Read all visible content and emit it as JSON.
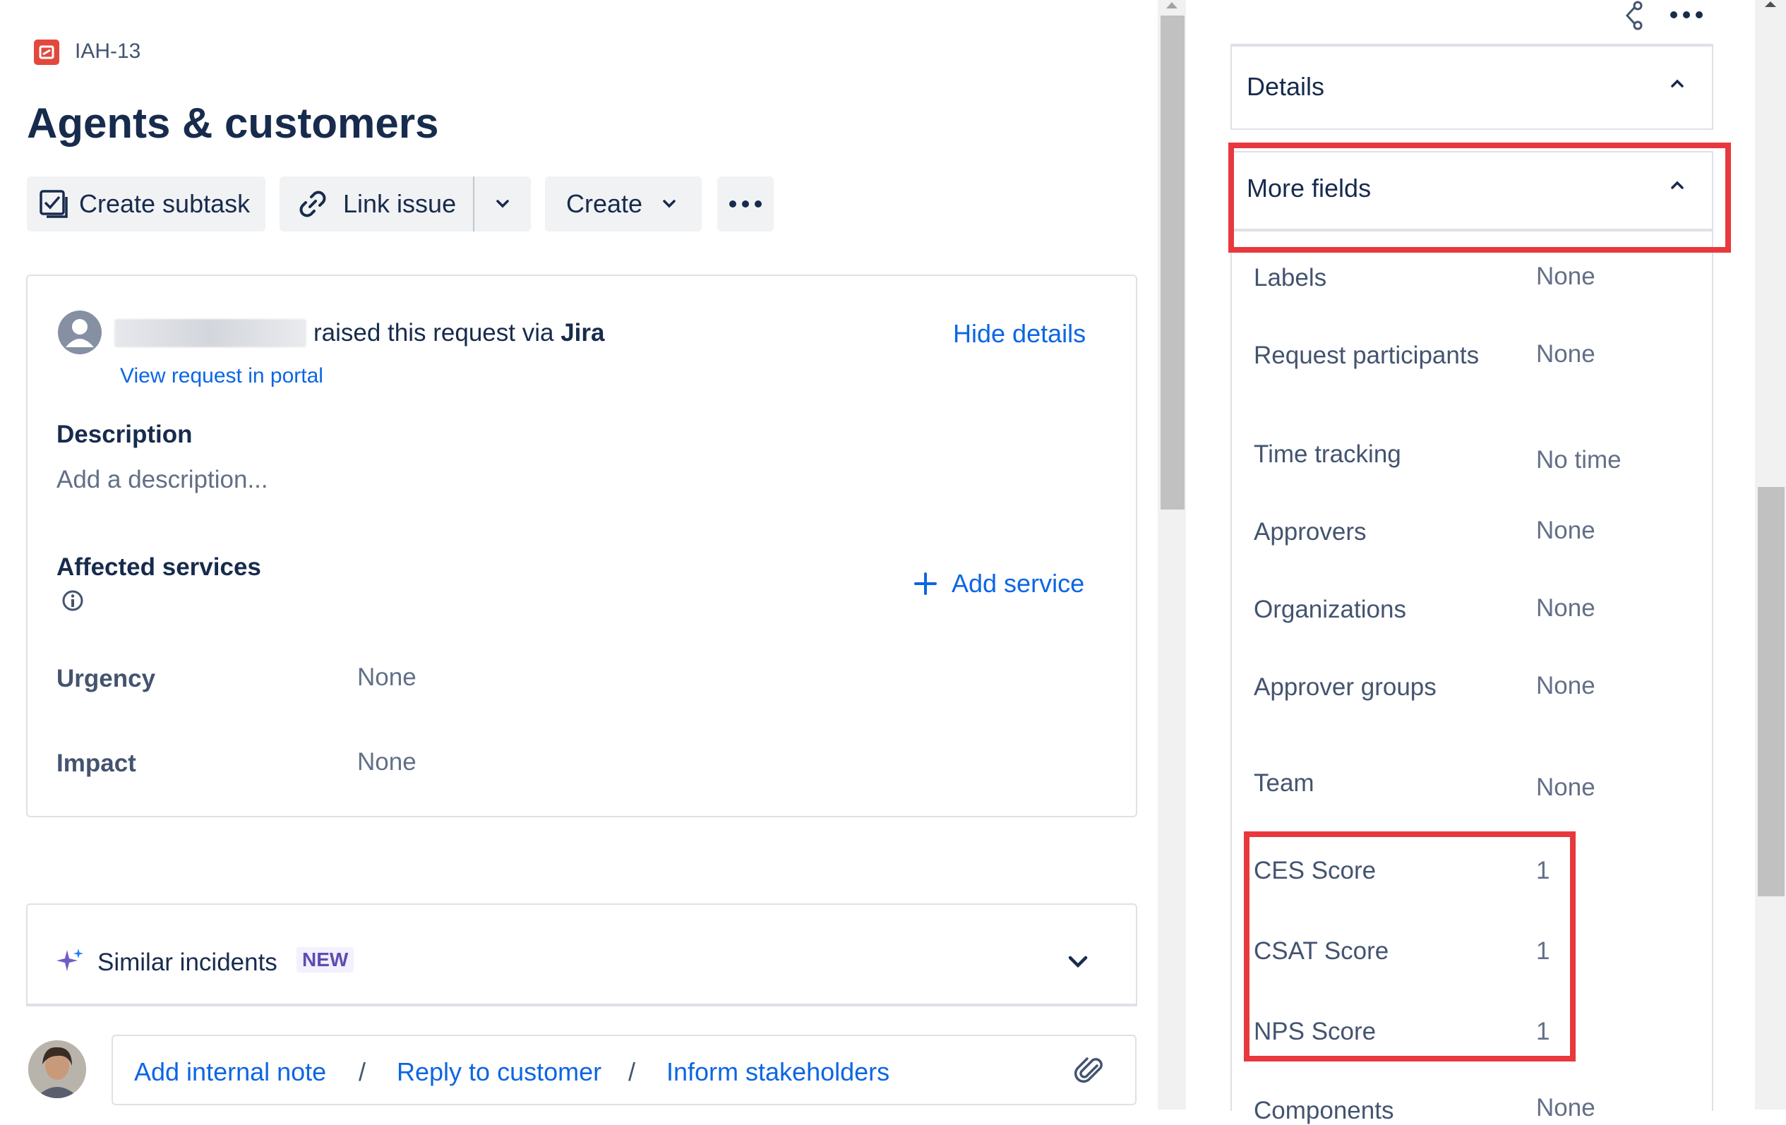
{
  "issue": {
    "key": "IAH-13",
    "title": "Agents & customers"
  },
  "toolbar": {
    "create_subtask": "Create subtask",
    "link_issue": "Link issue",
    "create": "Create"
  },
  "request": {
    "raised_text": "raised this request via",
    "source": "Jira",
    "hide_details": "Hide details",
    "view_portal": "View request in portal",
    "description_label": "Description",
    "description_placeholder": "Add a description...",
    "affected_services_label": "Affected services",
    "add_service": "Add service",
    "urgency_label": "Urgency",
    "urgency_value": "None",
    "impact_label": "Impact",
    "impact_value": "None"
  },
  "similar": {
    "label": "Similar incidents",
    "badge": "NEW"
  },
  "comment": {
    "add_internal_note": "Add internal note",
    "reply_to_customer": "Reply to customer",
    "inform_stakeholders": "Inform stakeholders",
    "separator": "/"
  },
  "right_panel": {
    "details": "Details",
    "more_fields": "More fields",
    "fields": [
      {
        "label": "Labels",
        "value": "None"
      },
      {
        "label": "Request participants",
        "value": "None"
      },
      {
        "label": "Time tracking",
        "value": "No time"
      },
      {
        "label": "Approvers",
        "value": "None"
      },
      {
        "label": "Organizations",
        "value": "None"
      },
      {
        "label": "Approver groups",
        "value": "None"
      },
      {
        "label": "Team",
        "value": "None"
      },
      {
        "label": "CES Score",
        "value": "1"
      },
      {
        "label": "CSAT Score",
        "value": "1"
      },
      {
        "label": "NPS Score",
        "value": "1"
      },
      {
        "label": "Components",
        "value": "None"
      }
    ]
  },
  "colors": {
    "accent": "#0c66e4",
    "highlight": "#e8383d",
    "button_bg": "#f1f2f4",
    "badge_bg": "#f3f0ff",
    "badge_text": "#5e4db2"
  }
}
